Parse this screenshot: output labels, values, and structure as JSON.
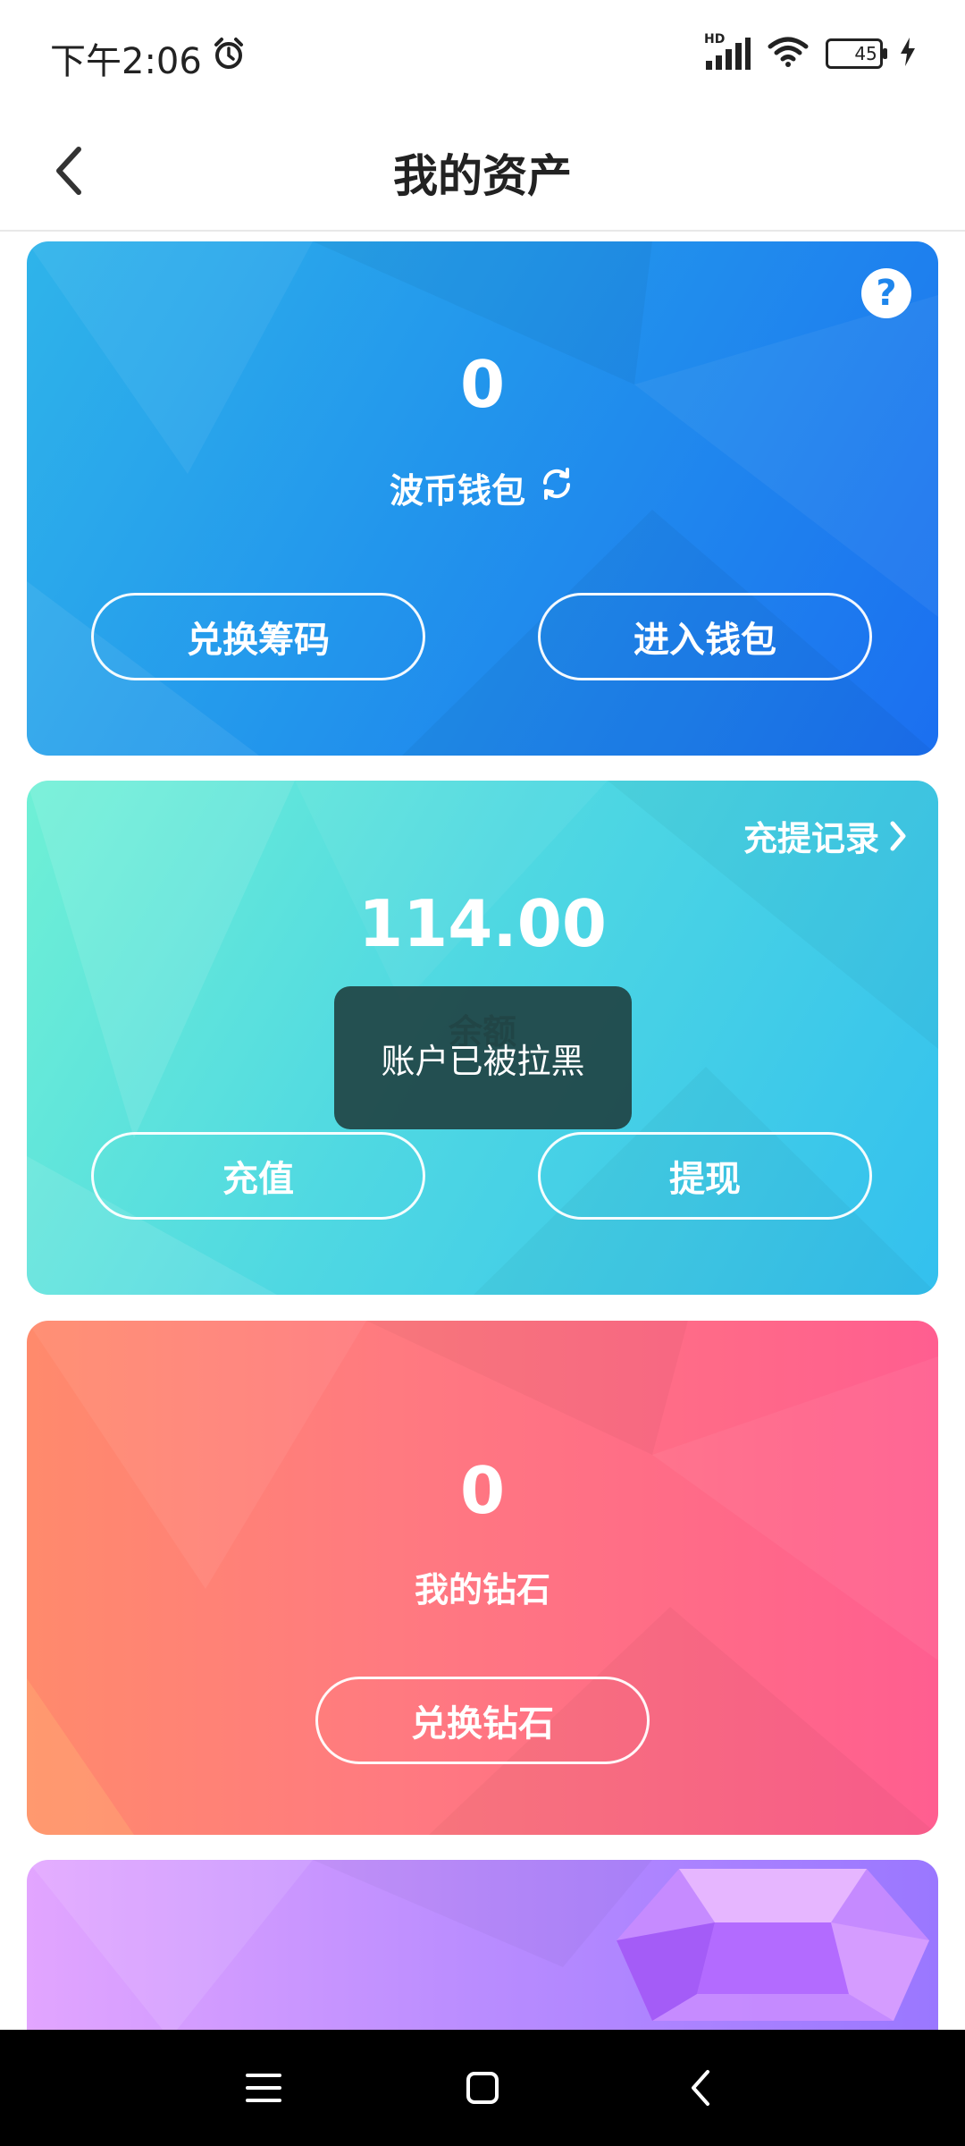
{
  "status": {
    "time": "下午2:06",
    "signal_label": "HD",
    "battery": "45"
  },
  "header": {
    "title": "我的资产"
  },
  "wallet_card": {
    "value": "0",
    "label": "波币钱包",
    "btn_exchange": "兑换筹码",
    "btn_enter": "进入钱包"
  },
  "balance_card": {
    "record_link": "充提记录",
    "value": "114.00",
    "label": "余额",
    "btn_recharge": "充值",
    "btn_withdraw": "提现"
  },
  "diamond_card": {
    "value": "0",
    "label": "我的钻石",
    "btn_exchange": "兑换钻石"
  },
  "toast": {
    "message": "账户已被拉黑"
  },
  "colors": {
    "wallet": "#2295ec",
    "balance": "#4fd8e2",
    "diamond": "#ff6a88",
    "gem": "#b98cff"
  }
}
